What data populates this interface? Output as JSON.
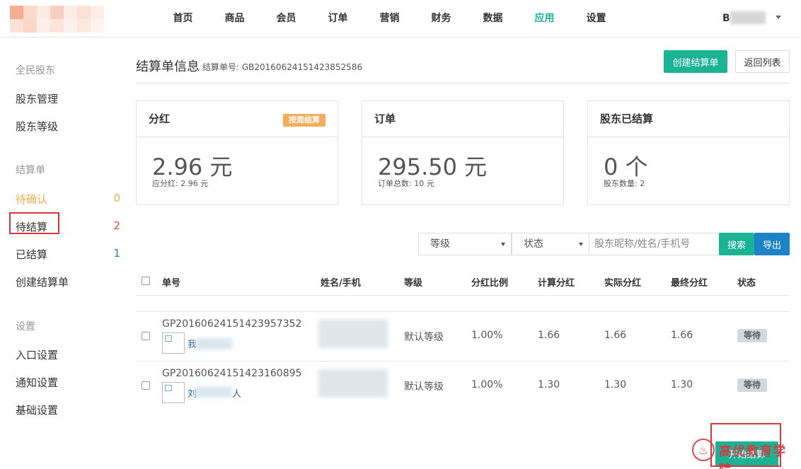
{
  "nav": {
    "items": [
      "首页",
      "商品",
      "会员",
      "订单",
      "营销",
      "财务",
      "数据",
      "应用",
      "设置"
    ],
    "active_index": 7,
    "user_initial": "B"
  },
  "sidebar": {
    "group1": {
      "title": "全民股东",
      "items": [
        "股东管理",
        "股东等级"
      ]
    },
    "group2": {
      "title": "结算单",
      "items": [
        {
          "label": "待确认",
          "count": "0"
        },
        {
          "label": "待结算",
          "count": "2"
        },
        {
          "label": "已结算",
          "count": "1"
        },
        {
          "label": "创建结算单"
        }
      ]
    },
    "group3": {
      "title": "设置",
      "items": [
        "入口设置",
        "通知设置",
        "基础设置"
      ]
    }
  },
  "header": {
    "title": "结算单信息",
    "order_no": "结算单号: GB20160624151423852586",
    "create_button": "创建结算单",
    "back_button": "返回列表"
  },
  "cards": [
    {
      "title": "分红",
      "badge": "按周结算",
      "value": "2.96 元",
      "sub": "应分红: 2.96 元"
    },
    {
      "title": "订单",
      "value": "295.50 元",
      "sub": "订单总数: 10 元"
    },
    {
      "title": "股东已结算",
      "value": "0 个",
      "sub": "股东数量: 2"
    }
  ],
  "filters": {
    "level_select": "等级",
    "status_select": "状态",
    "search_placeholder": "股东昵称/姓名/手机号",
    "search_button": "搜索",
    "export_button": "导出"
  },
  "table": {
    "headers": [
      "单号",
      "姓名/手机",
      "等级",
      "分红比例",
      "计算分红",
      "实际分红",
      "最终分红",
      "状态"
    ],
    "rows": [
      {
        "id": "GP20160624151423957352",
        "name_visible": "我",
        "level": "默认等级",
        "ratio": "1.00%",
        "calc": "1.66",
        "actual": "1.66",
        "final": "1.66",
        "status": "等待"
      },
      {
        "id": "GP20160624151423160895",
        "name_visible": "刘",
        "name_tail": "人",
        "level": "默认等级",
        "ratio": "1.00%",
        "calc": "1.30",
        "actual": "1.30",
        "final": "1.30",
        "status": "等待"
      }
    ]
  },
  "footer": {
    "start_button": "开始结算"
  },
  "watermark": {
    "text": "高优教育学院"
  }
}
